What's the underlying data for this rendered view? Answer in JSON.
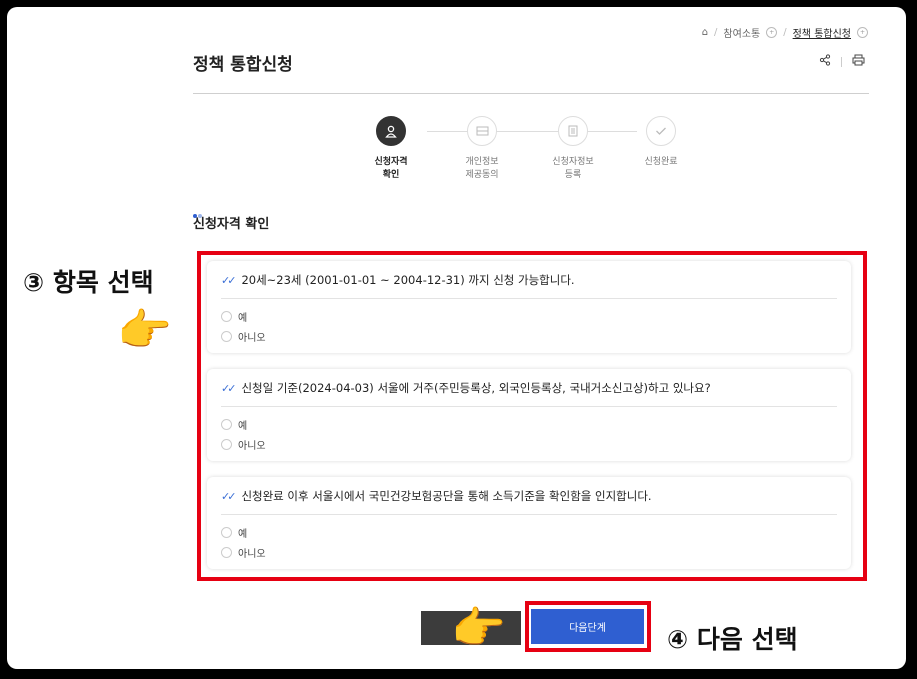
{
  "breadcrumb": {
    "items": [
      "참여소통",
      "정책 통합신청"
    ]
  },
  "page": {
    "title": "정책 통합신청"
  },
  "steps": [
    {
      "label": "신청자격\n확인",
      "active": true,
      "icon": "person-icon"
    },
    {
      "label": "개인정보\n제공동의",
      "active": false,
      "icon": "document-icon"
    },
    {
      "label": "신청자정보\n등록",
      "active": false,
      "icon": "form-icon"
    },
    {
      "label": "신청완료",
      "active": false,
      "icon": "check-icon"
    }
  ],
  "section": {
    "title": "신청자격 확인"
  },
  "questions": [
    {
      "text": "20세~23세 (2001-01-01 ~ 2004-12-31) 까지 신청 가능합니다.",
      "options": [
        "예",
        "아니오"
      ]
    },
    {
      "text": "신청일 기준(2024-04-03) 서울에 거주(주민등록상, 외국인등록상, 국내거소신고상)하고 있나요?",
      "options": [
        "예",
        "아니오"
      ]
    },
    {
      "text": "신청완료 이후 서울시에서 국민건강보험공단을 통해 소득기준을 확인함을 인지합니다.",
      "options": [
        "예",
        "아니오"
      ]
    }
  ],
  "buttons": {
    "next": "다음단계"
  },
  "annotations": {
    "step3": "③ 항목 선택",
    "step4": "④ 다음 선택"
  },
  "colors": {
    "accent": "#2f5fd1",
    "highlight": "#e60012"
  }
}
